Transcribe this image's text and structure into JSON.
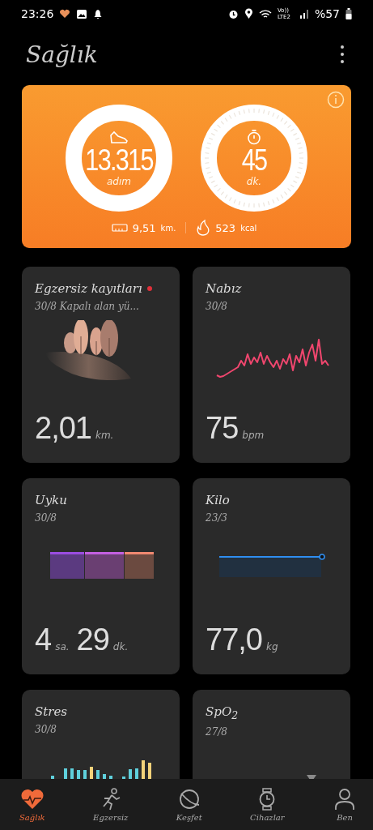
{
  "status_bar": {
    "time": "23:26",
    "network": "Vo)) LTE2",
    "battery": "%57"
  },
  "header": {
    "title": "Sağlık"
  },
  "activity": {
    "steps": {
      "value": "13.315",
      "unit": "adım"
    },
    "minutes": {
      "value": "45",
      "unit": "dk."
    },
    "distance": {
      "value": "9,51",
      "unit": "km."
    },
    "calories": {
      "value": "523",
      "unit": "kcal"
    }
  },
  "cards": [
    {
      "kind": "exercise",
      "title": "Egzersiz kayıtları",
      "unread": true,
      "subtitle": "30/8 Kapalı alan yü...",
      "value": [
        {
          "number": "2,01",
          "unit": "km."
        }
      ]
    },
    {
      "kind": "heart",
      "title": "Nabız",
      "unread": false,
      "subtitle": "30/8",
      "value": [
        {
          "number": "75",
          "unit": "bpm"
        }
      ]
    },
    {
      "kind": "sleep",
      "title": "Uyku",
      "unread": false,
      "subtitle": "30/8",
      "value": [
        {
          "number": "4",
          "unit": "sa."
        },
        {
          "number": "29",
          "unit": "dk."
        }
      ]
    },
    {
      "kind": "weight",
      "title": "Kilo",
      "unread": false,
      "subtitle": "23/3",
      "value": [
        {
          "number": "77,0",
          "unit": "kg"
        }
      ]
    },
    {
      "kind": "stress",
      "title": "Stres",
      "unread": false,
      "subtitle": "30/8"
    },
    {
      "kind": "spo2",
      "title": "SpO$_{2}$",
      "unread": false,
      "subtitle": "27/8"
    }
  ],
  "nav": [
    {
      "kind": "health",
      "label": "Sağlık",
      "selected": true
    },
    {
      "kind": "exercise",
      "label": "Egzersiz",
      "selected": false
    },
    {
      "kind": "discover",
      "label": "Keşfet",
      "selected": false
    },
    {
      "kind": "devices",
      "label": "Cihazlar",
      "selected": false
    },
    {
      "kind": "me",
      "label": "Ben",
      "selected": false
    }
  ]
}
